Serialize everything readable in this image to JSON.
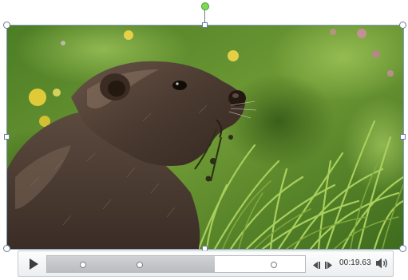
{
  "video": {
    "subject": "marmot",
    "colors": {
      "grass": "#5d8a2a",
      "fur": "#4a3a30",
      "flower": "#f0d23a"
    }
  },
  "selection": {
    "rotate_handle_color": "#7ed957",
    "handle_border_color": "#6d7d92"
  },
  "player": {
    "play_icon": "play-icon",
    "progress": 0.65,
    "bookmarks": [
      0.14,
      0.36,
      0.88
    ],
    "prev_icon": "skip-back-icon",
    "next_icon": "skip-forward-icon",
    "time": "00:19.63",
    "volume_icon": "speaker-icon"
  }
}
